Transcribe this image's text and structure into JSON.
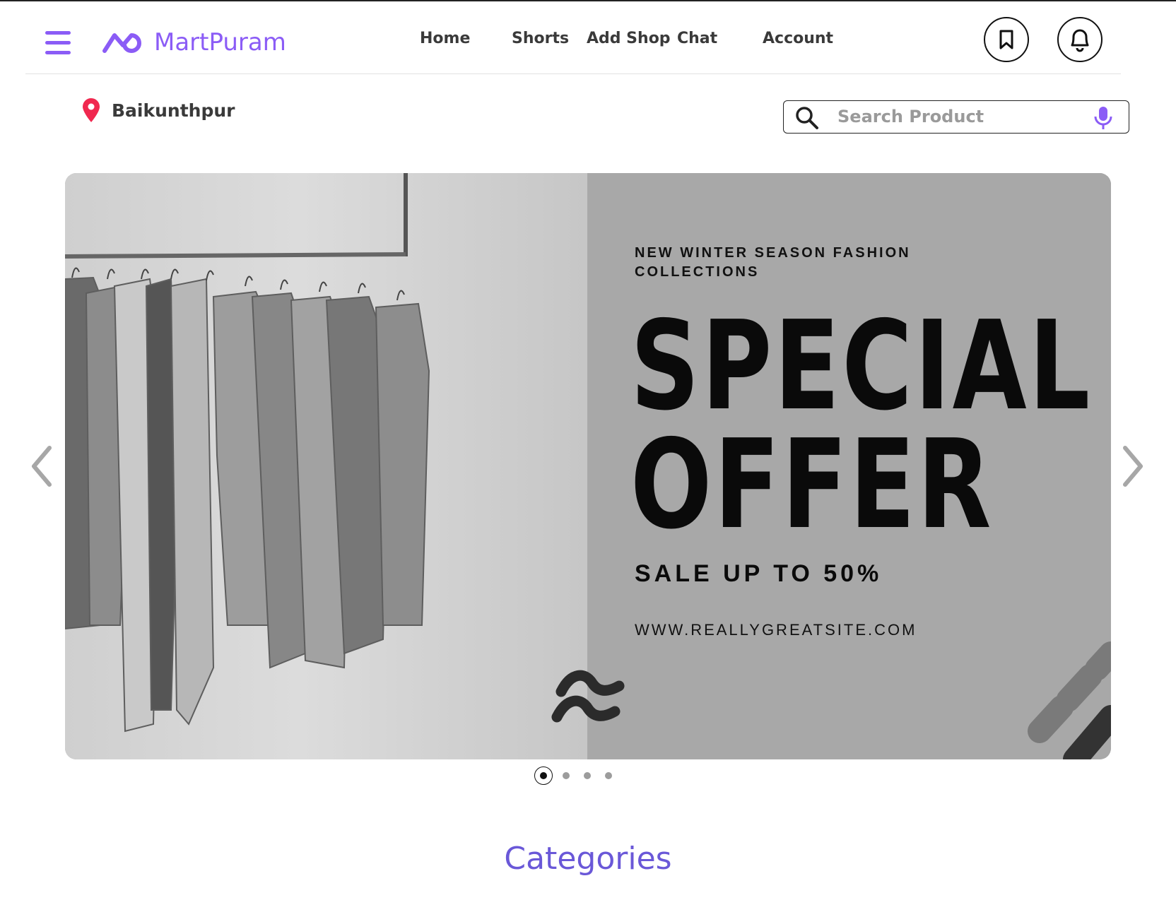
{
  "brand": {
    "name": "MartPuram",
    "color": "#8b5cf6"
  },
  "nav": {
    "home": "Home",
    "shorts": "Shorts",
    "add_shop": "Add Shop",
    "chat": "Chat",
    "account": "Account"
  },
  "header_icons": [
    "menu-icon",
    "bookmark-icon",
    "bell-icon"
  ],
  "location": {
    "name": "Baikunthpur",
    "icon": "map-pin-icon",
    "icon_color": "#f0284f"
  },
  "search": {
    "placeholder": "Search Product",
    "value": "",
    "icons": [
      "search-icon",
      "mic-icon"
    ]
  },
  "banner": {
    "subtitle": "NEW WINTER SEASON FASHION COLLECTIONS",
    "title_line1": "SPECIAL",
    "title_line2": "OFFER",
    "sale": "SALE UP TO 50%",
    "url": "WWW.REALLYGREATSITE.COM",
    "slides_total": 4,
    "active_slide": 1
  },
  "section": {
    "categories": "Categories",
    "color": "#6a58d8"
  }
}
